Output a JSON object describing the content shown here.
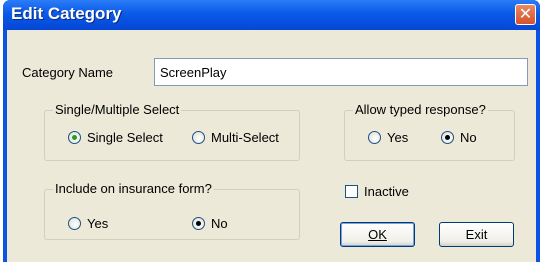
{
  "window": {
    "title": "Edit Category",
    "close_glyph": "✕"
  },
  "category_name": {
    "label": "Category Name",
    "value": "ScreenPlay"
  },
  "select_group": {
    "legend": "Single/Multiple Select",
    "options": [
      "Single Select",
      "Multi-Select"
    ],
    "selected": "Single Select"
  },
  "typed_group": {
    "legend": "Allow typed response?",
    "options": [
      "Yes",
      "No"
    ],
    "selected": "No"
  },
  "insurance_group": {
    "legend": "Include on insurance form?",
    "options": [
      "Yes",
      "No"
    ],
    "selected": "No"
  },
  "inactive": {
    "label": "Inactive",
    "checked": false
  },
  "buttons": {
    "ok": "OK",
    "exit": "Exit"
  },
  "icons": [
    "close-icon",
    "radio-icon",
    "checkbox-icon"
  ]
}
